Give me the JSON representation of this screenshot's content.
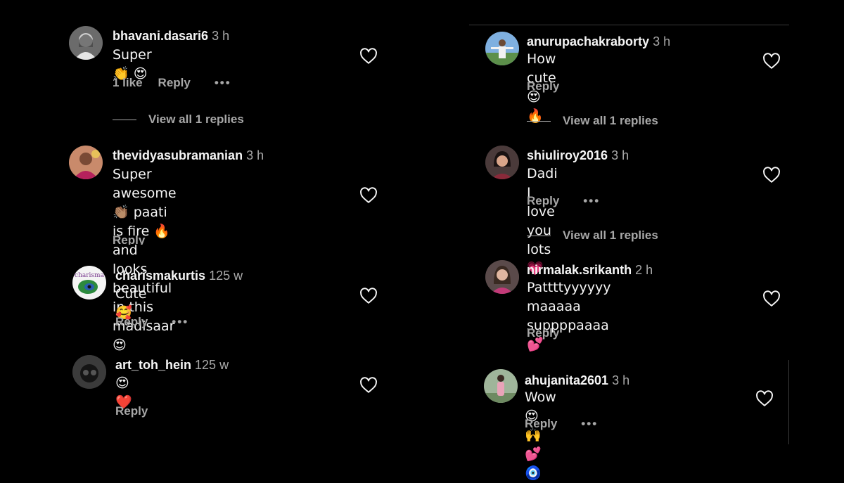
{
  "left_comments": [
    {
      "username": "bhavani.dasari6",
      "time": "3 h",
      "text": "Super 👏 😍",
      "likes": "1 like",
      "reply": "Reply",
      "has_more": true,
      "view_replies": "View all 1 replies"
    },
    {
      "username": "thevidyasubramanian",
      "time": "3 h",
      "text": "Super awesome 👏🏽 paati is fire 🔥\nand looks beautiful in this madisaar\n😍",
      "reply": "Reply",
      "has_more": false
    },
    {
      "username": "charismakurtis",
      "time": "125 w",
      "text": "Cute 🥰",
      "reply": "Reply",
      "has_more": true
    },
    {
      "username": "art_toh_hein",
      "time": "125 w",
      "text": "😍 ❤️",
      "reply": "Reply",
      "has_more": false
    }
  ],
  "right_comments": [
    {
      "username": "anurupachakraborty",
      "time": "3 h",
      "text": "How cute 😍 🔥",
      "reply": "Reply",
      "has_more": false,
      "view_replies": "View all 1 replies"
    },
    {
      "username": "shiuliroy2016",
      "time": "3 h",
      "text": "Dadi I love you lots 💗",
      "reply": "Reply",
      "has_more": true,
      "view_replies": "View all 1 replies"
    },
    {
      "username": "nirmalak.srikanth",
      "time": "2 h",
      "text": "Pattttyyyyyy maaaaa suppppaaaa\n💕",
      "reply": "Reply",
      "has_more": false
    },
    {
      "username": "ahujanita2601",
      "time": "3 h",
      "text": "Wow 😍 🙌 💕 🧿",
      "reply": "Reply",
      "has_more": true
    }
  ],
  "more_label": "•••",
  "icons": {
    "like": "heart-outline-icon",
    "more": "more-dots-icon"
  },
  "colors": {
    "background": "#000000",
    "text": "#f5f5f5",
    "secondary": "#a8a8a8"
  }
}
